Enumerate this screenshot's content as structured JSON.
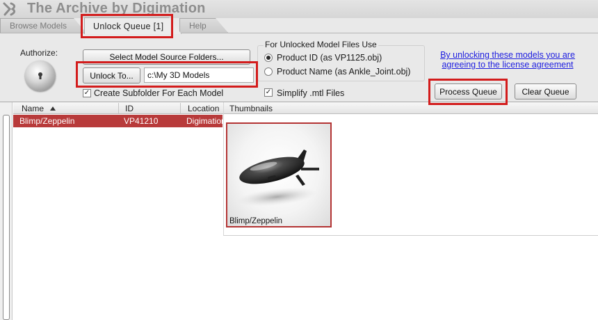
{
  "window": {
    "title": "The Archive by Digimation"
  },
  "tabs": [
    {
      "label": "Browse Models",
      "active": false
    },
    {
      "label": "Unlock Queue [1]",
      "active": true
    },
    {
      "label": "Help",
      "active": false
    }
  ],
  "authorize": {
    "label": "Authorize:",
    "icon": "lock-dial-icon"
  },
  "toolbar": {
    "select_folders_label": "Select Model Source Folders...",
    "unlock_to_label": "Unlock To...",
    "unlock_path_value": "c:\\My 3D Models",
    "subfolder_label": "Create Subfolder For Each Model",
    "subfolder_checked": true
  },
  "naming": {
    "title": "For Unlocked Model Files Use",
    "options": [
      {
        "label": "Product ID (as VP1125.obj)",
        "selected": true
      },
      {
        "label": "Product Name (as Ankle_Joint.obj)",
        "selected": false
      }
    ],
    "simplify_label": "Simplify .mtl Files",
    "simplify_checked": true
  },
  "license_link": "By unlocking these models you are agreeing to the license agreement",
  "actions": {
    "process_label": "Process Queue",
    "clear_label": "Clear Queue"
  },
  "table": {
    "columns": [
      "Name",
      "ID",
      "Location",
      "Thumbnails"
    ],
    "sort": "ascending",
    "rows": [
      {
        "name": "Blimp/Zeppelin",
        "id": "VP41210",
        "location": "Digimation"
      }
    ]
  },
  "thumbnail": {
    "label": "Blimp/Zeppelin",
    "icon": "blimp-thumbnail"
  },
  "colors": {
    "highlight": "#d31c1c",
    "selected_row": "#b83a3a",
    "link": "#1d1de0"
  }
}
